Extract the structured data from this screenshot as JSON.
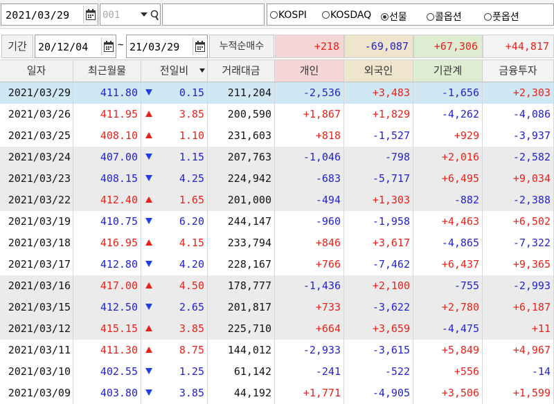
{
  "toolbar": {
    "date": "2021/03/29",
    "code_placeholder": "001",
    "name_value": "",
    "radios": [
      {
        "label": "KOSPI",
        "selected": false
      },
      {
        "label": "KOSDAQ",
        "selected": false
      },
      {
        "label": "선물",
        "selected": true
      },
      {
        "label": "콜옵션",
        "selected": false
      },
      {
        "label": "풋옵션",
        "selected": false
      }
    ]
  },
  "period": {
    "label": "기간",
    "from": "20/12/04",
    "tilde": "~",
    "to": "21/03/29",
    "cum_label": "누적순매수",
    "sums": [
      "+218",
      "-69,087",
      "+67,306",
      "+44,817"
    ]
  },
  "headers": [
    "일자",
    "최근월물",
    "전일비",
    "거래대금",
    "개인",
    "외국인",
    "기관계",
    "금융투자"
  ],
  "colors": {
    "up": "#e8211a",
    "down": "#2222cc",
    "selected_row": "#cfe8f3",
    "alt_row": "#ebebeb",
    "head_individual": "#f4d6d6",
    "head_foreign": "#efe4cc",
    "head_institution": "#deecd2",
    "head_finance": "#f3f3f3"
  },
  "rows": [
    {
      "date": "2021/03/29",
      "price": "411.80",
      "dir": "down",
      "change": "0.15",
      "volume": "211,204",
      "indiv": "-2,536",
      "foreign": "+3,483",
      "inst": "-1,656",
      "fin": "+2,303"
    },
    {
      "date": "2021/03/26",
      "price": "411.95",
      "dir": "up",
      "change": "3.85",
      "volume": "200,590",
      "indiv": "+1,867",
      "foreign": "+1,829",
      "inst": "-4,262",
      "fin": "-4,086"
    },
    {
      "date": "2021/03/25",
      "price": "408.10",
      "dir": "up",
      "change": "1.10",
      "volume": "231,603",
      "indiv": "+818",
      "foreign": "-1,527",
      "inst": "+929",
      "fin": "-3,937"
    },
    {
      "date": "2021/03/24",
      "price": "407.00",
      "dir": "down",
      "change": "1.15",
      "volume": "207,763",
      "indiv": "-1,046",
      "foreign": "-798",
      "inst": "+2,016",
      "fin": "-2,582"
    },
    {
      "date": "2021/03/23",
      "price": "408.15",
      "dir": "down",
      "change": "4.25",
      "volume": "224,942",
      "indiv": "-683",
      "foreign": "-5,717",
      "inst": "+6,495",
      "fin": "+9,034"
    },
    {
      "date": "2021/03/22",
      "price": "412.40",
      "dir": "up",
      "change": "1.65",
      "volume": "201,000",
      "indiv": "-494",
      "foreign": "+1,303",
      "inst": "-882",
      "fin": "-2,388"
    },
    {
      "date": "2021/03/19",
      "price": "410.75",
      "dir": "down",
      "change": "6.20",
      "volume": "244,147",
      "indiv": "-960",
      "foreign": "-1,958",
      "inst": "+4,463",
      "fin": "+6,502"
    },
    {
      "date": "2021/03/18",
      "price": "416.95",
      "dir": "up",
      "change": "4.15",
      "volume": "233,794",
      "indiv": "+846",
      "foreign": "+3,617",
      "inst": "-4,865",
      "fin": "-7,322"
    },
    {
      "date": "2021/03/17",
      "price": "412.80",
      "dir": "down",
      "change": "4.20",
      "volume": "228,167",
      "indiv": "+766",
      "foreign": "-7,462",
      "inst": "+6,437",
      "fin": "+9,365"
    },
    {
      "date": "2021/03/16",
      "price": "417.00",
      "dir": "up",
      "change": "4.50",
      "volume": "178,777",
      "indiv": "-1,436",
      "foreign": "+2,100",
      "inst": "-755",
      "fin": "-2,993"
    },
    {
      "date": "2021/03/15",
      "price": "412.50",
      "dir": "down",
      "change": "2.65",
      "volume": "201,817",
      "indiv": "+733",
      "foreign": "-3,622",
      "inst": "+2,780",
      "fin": "+6,187"
    },
    {
      "date": "2021/03/12",
      "price": "415.15",
      "dir": "up",
      "change": "3.85",
      "volume": "225,710",
      "indiv": "+664",
      "foreign": "+3,659",
      "inst": "-4,475",
      "fin": "+11"
    },
    {
      "date": "2021/03/11",
      "price": "411.30",
      "dir": "up",
      "change": "8.75",
      "volume": "144,012",
      "indiv": "-2,933",
      "foreign": "-3,615",
      "inst": "+5,849",
      "fin": "+4,967"
    },
    {
      "date": "2021/03/10",
      "price": "402.55",
      "dir": "down",
      "change": "1.25",
      "volume": "61,142",
      "indiv": "-241",
      "foreign": "-522",
      "inst": "+556",
      "fin": "-14"
    },
    {
      "date": "2021/03/09",
      "price": "403.80",
      "dir": "down",
      "change": "3.85",
      "volume": "44,192",
      "indiv": "+1,771",
      "foreign": "-4,905",
      "inst": "+3,506",
      "fin": "+1,599"
    }
  ]
}
